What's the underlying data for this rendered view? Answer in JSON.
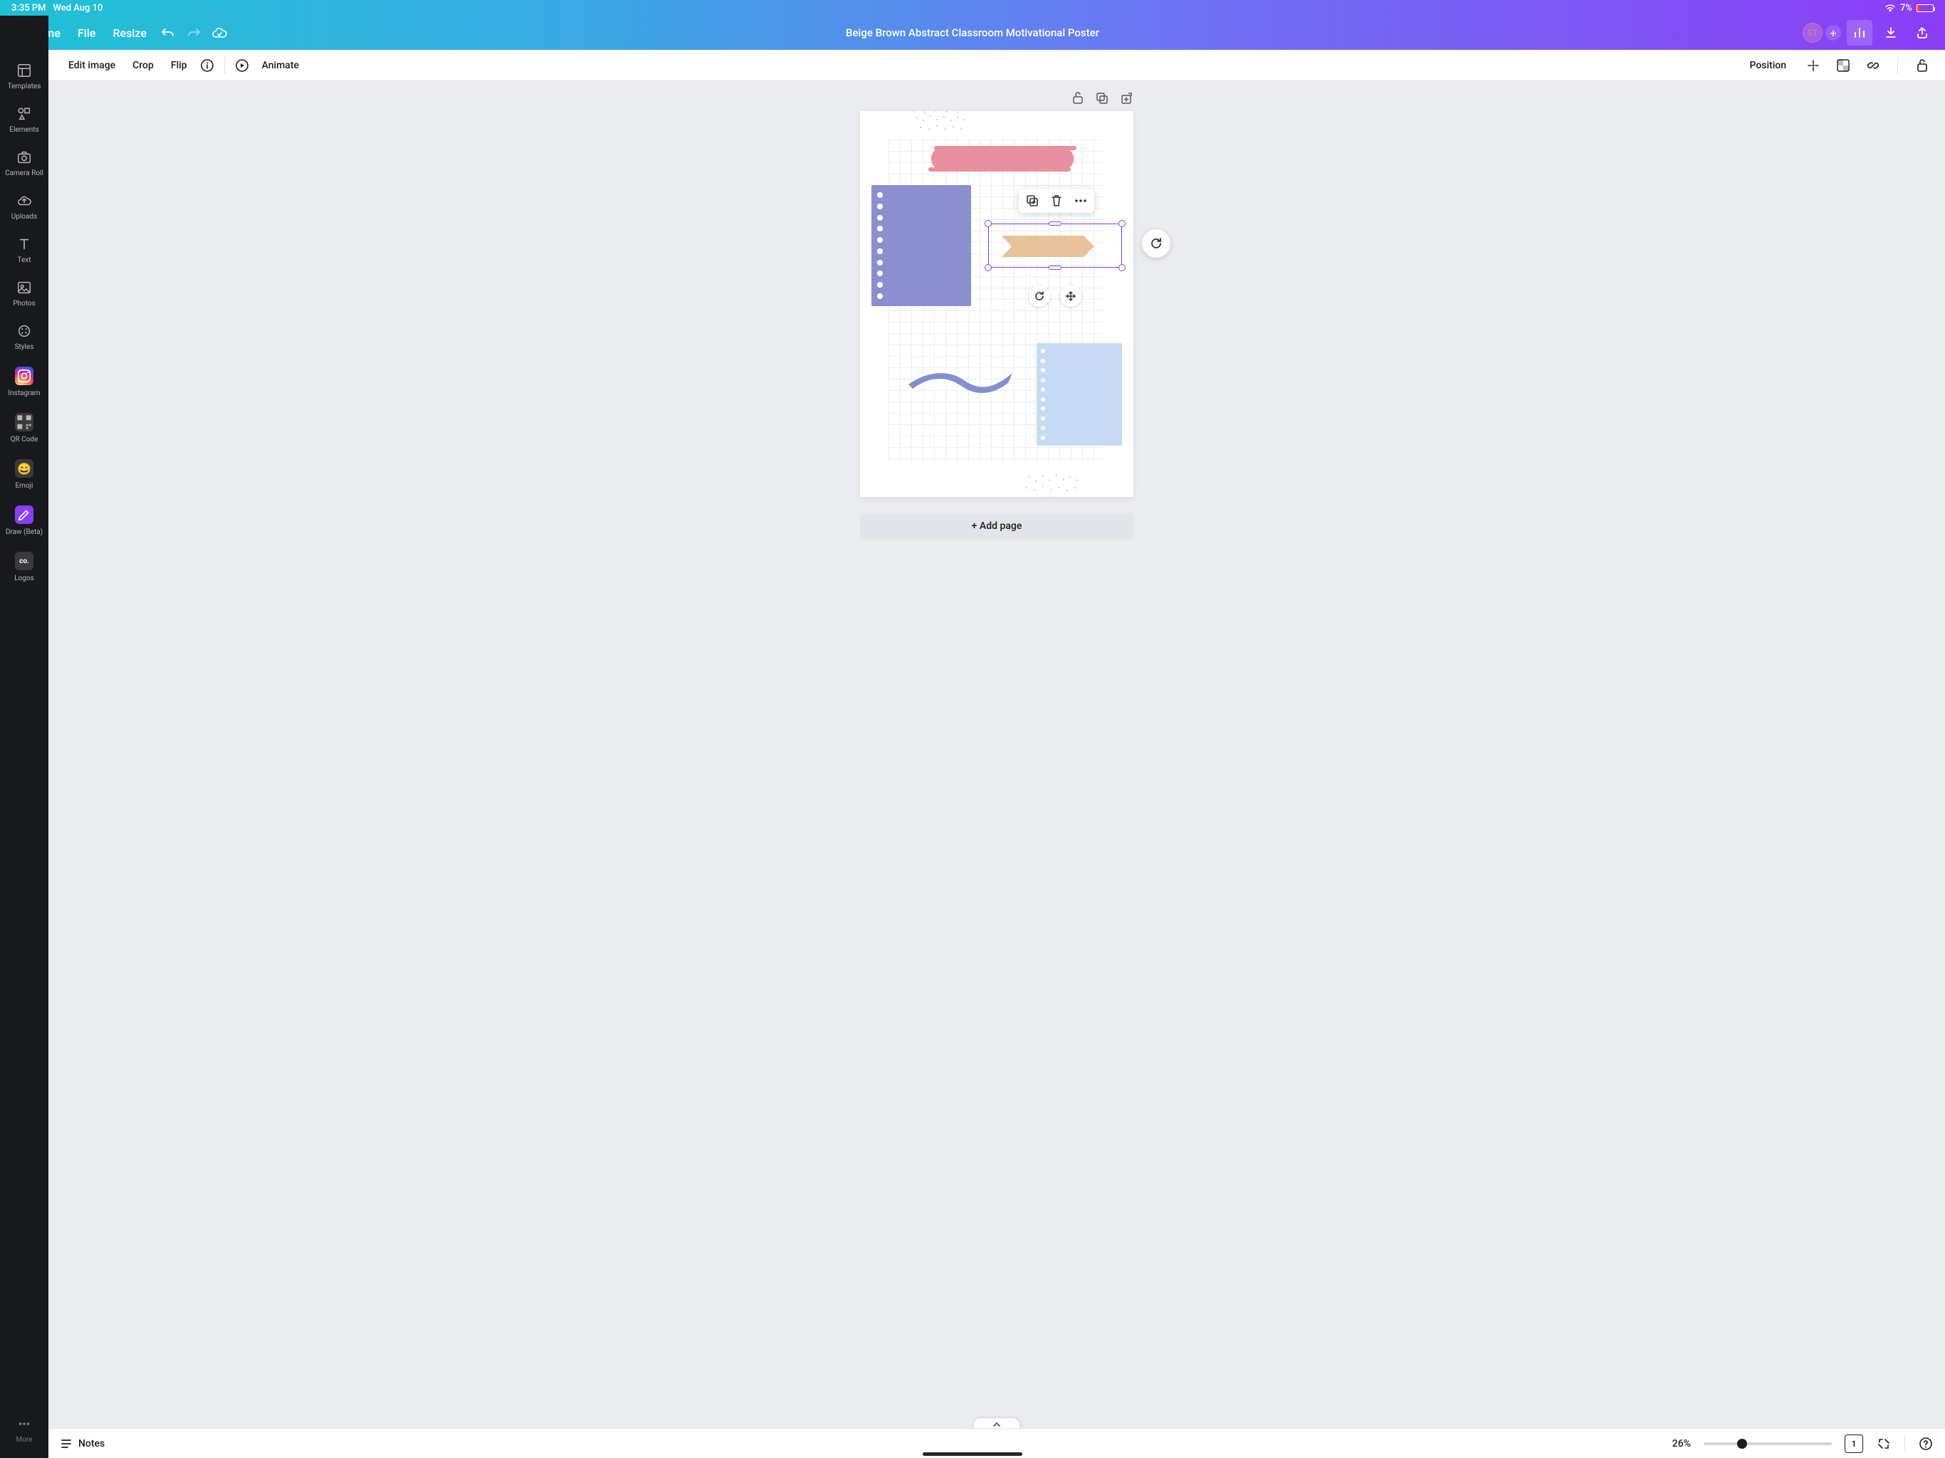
{
  "status_bar": {
    "time": "3:35 PM",
    "date": "Wed Aug 10",
    "battery": "7%"
  },
  "topnav": {
    "home": "Home",
    "file": "File",
    "resize": "Resize",
    "doc_title": "Beige Brown Abstract Classroom Motivational Poster",
    "avatar_initials": "ST"
  },
  "toolbar": {
    "edit_image": "Edit image",
    "crop": "Crop",
    "flip": "Flip",
    "animate": "Animate",
    "position": "Position"
  },
  "sidebar": {
    "items": [
      {
        "label": "Templates"
      },
      {
        "label": "Elements"
      },
      {
        "label": "Camera Roll"
      },
      {
        "label": "Uploads"
      },
      {
        "label": "Text"
      },
      {
        "label": "Photos"
      },
      {
        "label": "Styles"
      },
      {
        "label": "Instagram"
      },
      {
        "label": "QR Code"
      },
      {
        "label": "Emoji"
      },
      {
        "label": "Draw (Beta)"
      },
      {
        "label": "Logos"
      },
      {
        "label": "More"
      }
    ]
  },
  "canvas": {
    "add_page": "+ Add page"
  },
  "bottom": {
    "notes": "Notes",
    "zoom_pct": "26%",
    "page_count": "1"
  }
}
